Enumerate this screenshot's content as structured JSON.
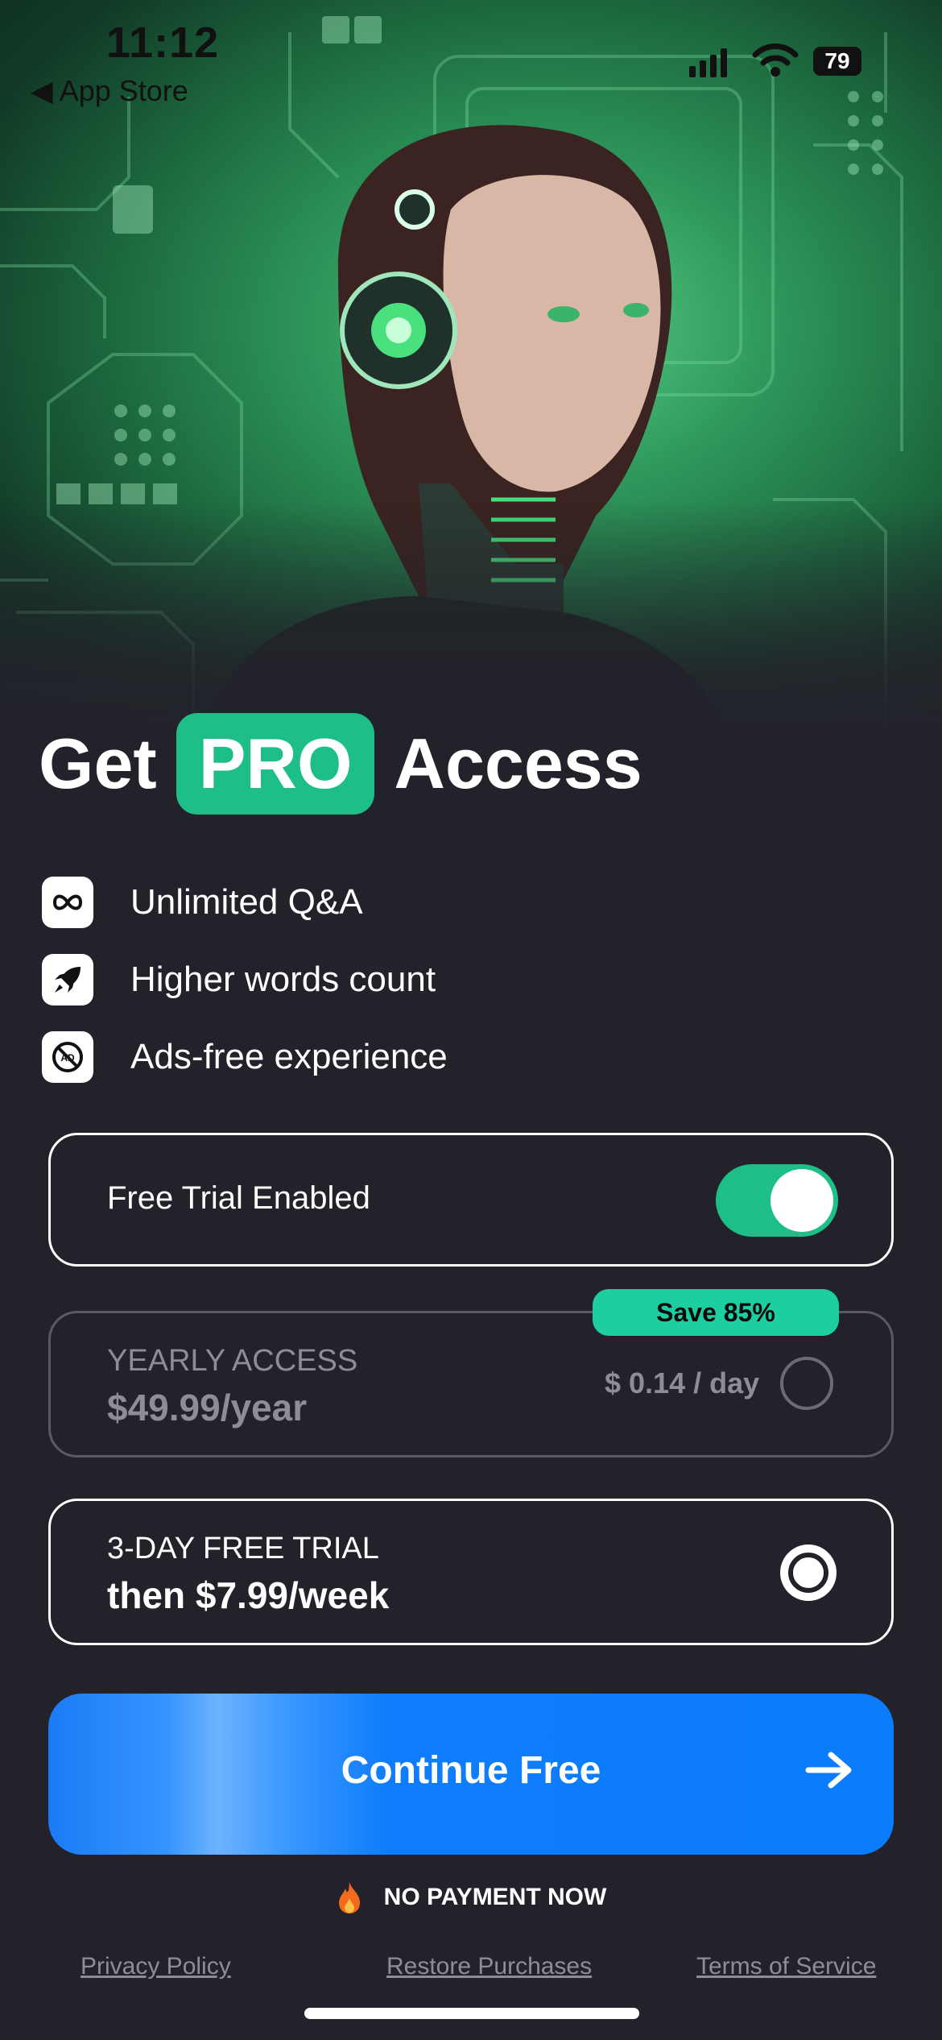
{
  "status_bar": {
    "time": "11:12",
    "back_label": "◀ App Store",
    "battery": "79"
  },
  "headline": {
    "prefix": "Get",
    "highlight": "PRO",
    "suffix": "Access"
  },
  "features": [
    {
      "icon": "infinity-icon",
      "label": "Unlimited Q&A"
    },
    {
      "icon": "rocket-icon",
      "label": "Higher words count"
    },
    {
      "icon": "no-ads-icon",
      "label": "Ads-free experience"
    }
  ],
  "free_trial_toggle": {
    "label": "Free Trial Enabled",
    "enabled": true
  },
  "plans": {
    "yearly": {
      "title": "YEARLY ACCESS",
      "price": "$49.99/year",
      "per_day": "$ 0.14 / day",
      "badge": "Save 85%",
      "selected": false
    },
    "weekly": {
      "title": "3-DAY FREE TRIAL",
      "price": "then $7.99/week",
      "selected": true
    }
  },
  "cta": {
    "label": "Continue Free"
  },
  "no_payment": {
    "label": "NO PAYMENT NOW"
  },
  "footer": {
    "privacy": "Privacy Policy",
    "restore": "Restore Purchases",
    "terms": "Terms of Service"
  },
  "colors": {
    "accent_green": "#1dbf86",
    "badge_green": "#1dcea0",
    "cta_blue": "#0a7cfc",
    "background": "#23222b"
  }
}
